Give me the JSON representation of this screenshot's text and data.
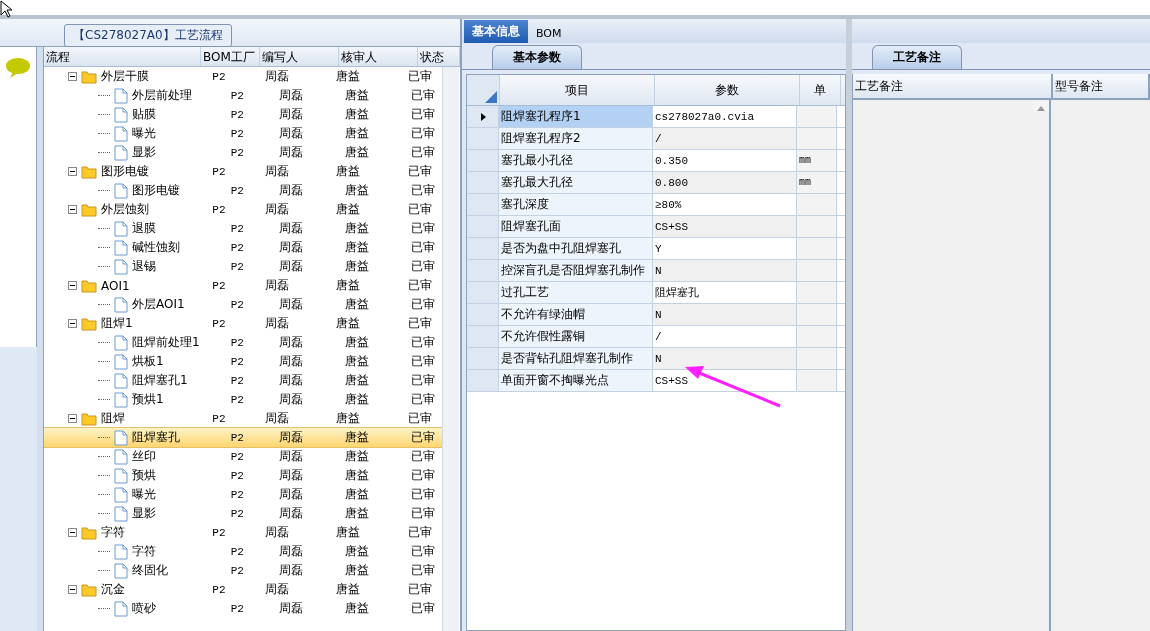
{
  "flow_panel": {
    "title": "【CS278027A0】工艺流程",
    "columns": [
      "流程",
      "BOM工厂",
      "编写人",
      "核审人",
      "状态"
    ],
    "tree": [
      {
        "name": "外层干膜",
        "bom": "P2",
        "writer": "周磊",
        "reviewer": "唐益",
        "status": "已审",
        "selected": false,
        "expanded": true,
        "children": [
          {
            "name": "外层前处理",
            "bom": "P2",
            "writer": "周磊",
            "reviewer": "唐益",
            "status": "已审",
            "selected": false
          },
          {
            "name": "贴膜",
            "bom": "P2",
            "writer": "周磊",
            "reviewer": "唐益",
            "status": "已审",
            "selected": false
          },
          {
            "name": "曝光",
            "bom": "P2",
            "writer": "周磊",
            "reviewer": "唐益",
            "status": "已审",
            "selected": false
          },
          {
            "name": "显影",
            "bom": "P2",
            "writer": "周磊",
            "reviewer": "唐益",
            "status": "已审",
            "selected": false
          }
        ]
      },
      {
        "name": "图形电镀",
        "bom": "P2",
        "writer": "周磊",
        "reviewer": "唐益",
        "status": "已审",
        "selected": false,
        "expanded": true,
        "children": [
          {
            "name": "图形电镀",
            "bom": "P2",
            "writer": "周磊",
            "reviewer": "唐益",
            "status": "已审",
            "selected": false
          }
        ]
      },
      {
        "name": "外层蚀刻",
        "bom": "P2",
        "writer": "周磊",
        "reviewer": "唐益",
        "status": "已审",
        "selected": false,
        "expanded": true,
        "children": [
          {
            "name": "退膜",
            "bom": "P2",
            "writer": "周磊",
            "reviewer": "唐益",
            "status": "已审",
            "selected": false
          },
          {
            "name": "碱性蚀刻",
            "bom": "P2",
            "writer": "周磊",
            "reviewer": "唐益",
            "status": "已审",
            "selected": false
          },
          {
            "name": "退锡",
            "bom": "P2",
            "writer": "周磊",
            "reviewer": "唐益",
            "status": "已审",
            "selected": false
          }
        ]
      },
      {
        "name": "AOI1",
        "bom": "P2",
        "writer": "周磊",
        "reviewer": "唐益",
        "status": "已审",
        "selected": false,
        "expanded": true,
        "children": [
          {
            "name": "外层AOI1",
            "bom": "P2",
            "writer": "周磊",
            "reviewer": "唐益",
            "status": "已审",
            "selected": false
          }
        ]
      },
      {
        "name": "阻焊1",
        "bom": "P2",
        "writer": "周磊",
        "reviewer": "唐益",
        "status": "已审",
        "selected": false,
        "expanded": true,
        "children": [
          {
            "name": "阻焊前处理1",
            "bom": "P2",
            "writer": "周磊",
            "reviewer": "唐益",
            "status": "已审",
            "selected": false
          },
          {
            "name": "烘板1",
            "bom": "P2",
            "writer": "周磊",
            "reviewer": "唐益",
            "status": "已审",
            "selected": false
          },
          {
            "name": "阻焊塞孔1",
            "bom": "P2",
            "writer": "周磊",
            "reviewer": "唐益",
            "status": "已审",
            "selected": false
          },
          {
            "name": "预烘1",
            "bom": "P2",
            "writer": "周磊",
            "reviewer": "唐益",
            "status": "已审",
            "selected": false
          }
        ]
      },
      {
        "name": "阻焊",
        "bom": "P2",
        "writer": "周磊",
        "reviewer": "唐益",
        "status": "已审",
        "selected": false,
        "expanded": true,
        "children": [
          {
            "name": "阻焊塞孔",
            "bom": "P2",
            "writer": "周磊",
            "reviewer": "唐益",
            "status": "已审",
            "selected": true
          },
          {
            "name": "丝印",
            "bom": "P2",
            "writer": "周磊",
            "reviewer": "唐益",
            "status": "已审",
            "selected": false
          },
          {
            "name": "预烘",
            "bom": "P2",
            "writer": "周磊",
            "reviewer": "唐益",
            "status": "已审",
            "selected": false
          },
          {
            "name": "曝光",
            "bom": "P2",
            "writer": "周磊",
            "reviewer": "唐益",
            "status": "已审",
            "selected": false
          },
          {
            "name": "显影",
            "bom": "P2",
            "writer": "周磊",
            "reviewer": "唐益",
            "status": "已审",
            "selected": false
          }
        ]
      },
      {
        "name": "字符",
        "bom": "P2",
        "writer": "周磊",
        "reviewer": "唐益",
        "status": "已审",
        "selected": false,
        "expanded": true,
        "children": [
          {
            "name": "字符",
            "bom": "P2",
            "writer": "周磊",
            "reviewer": "唐益",
            "status": "已审",
            "selected": false
          },
          {
            "name": "终固化",
            "bom": "P2",
            "writer": "周磊",
            "reviewer": "唐益",
            "status": "已审",
            "selected": false
          }
        ]
      },
      {
        "name": "沉金",
        "bom": "P2",
        "writer": "周磊",
        "reviewer": "唐益",
        "status": "已审",
        "selected": false,
        "expanded": true,
        "children": [
          {
            "name": "喷砂",
            "bom": "P2",
            "writer": "周磊",
            "reviewer": "唐益",
            "status": "已审",
            "selected": false
          }
        ]
      }
    ]
  },
  "detail_tabs": [
    {
      "label": "基本信息",
      "selected": true
    },
    {
      "label": "BOM",
      "selected": false
    }
  ],
  "param_panel": {
    "tab": "基本参数",
    "columns": [
      "项目",
      "参数",
      "单"
    ],
    "rows": [
      {
        "item": "阻焊塞孔程序1",
        "value": "cs278027a0.cvia",
        "unit": "",
        "selected": true
      },
      {
        "item": "阻焊塞孔程序2",
        "value": "/",
        "unit": "",
        "selected": false
      },
      {
        "item": "塞孔最小孔径",
        "value": "0.350",
        "unit": "mm",
        "selected": false
      },
      {
        "item": "塞孔最大孔径",
        "value": "0.800",
        "unit": "mm",
        "selected": false
      },
      {
        "item": "塞孔深度",
        "value": "≥80%",
        "unit": "",
        "selected": false
      },
      {
        "item": "阻焊塞孔面",
        "value": "CS+SS",
        "unit": "",
        "selected": false
      },
      {
        "item": "是否为盘中孔阻焊塞孔",
        "value": "Y",
        "unit": "",
        "selected": false
      },
      {
        "item": "控深盲孔是否阻焊塞孔制作",
        "value": "N",
        "unit": "",
        "selected": false
      },
      {
        "item": "过孔工艺",
        "value": "阻焊塞孔",
        "unit": "",
        "selected": false
      },
      {
        "item": "不允许有绿油帽",
        "value": "N",
        "unit": "",
        "selected": false
      },
      {
        "item": "不允许假性露铜",
        "value": "/",
        "unit": "",
        "selected": false
      },
      {
        "item": "是否背钻孔阻焊塞孔制作",
        "value": "N",
        "unit": "",
        "selected": false
      },
      {
        "item": "单面开窗不掏曝光点",
        "value": "CS+SS",
        "unit": "",
        "selected": false
      }
    ]
  },
  "notes_panel": {
    "tab": "工艺备注",
    "columns": [
      "工艺备注",
      "型号备注"
    ]
  }
}
